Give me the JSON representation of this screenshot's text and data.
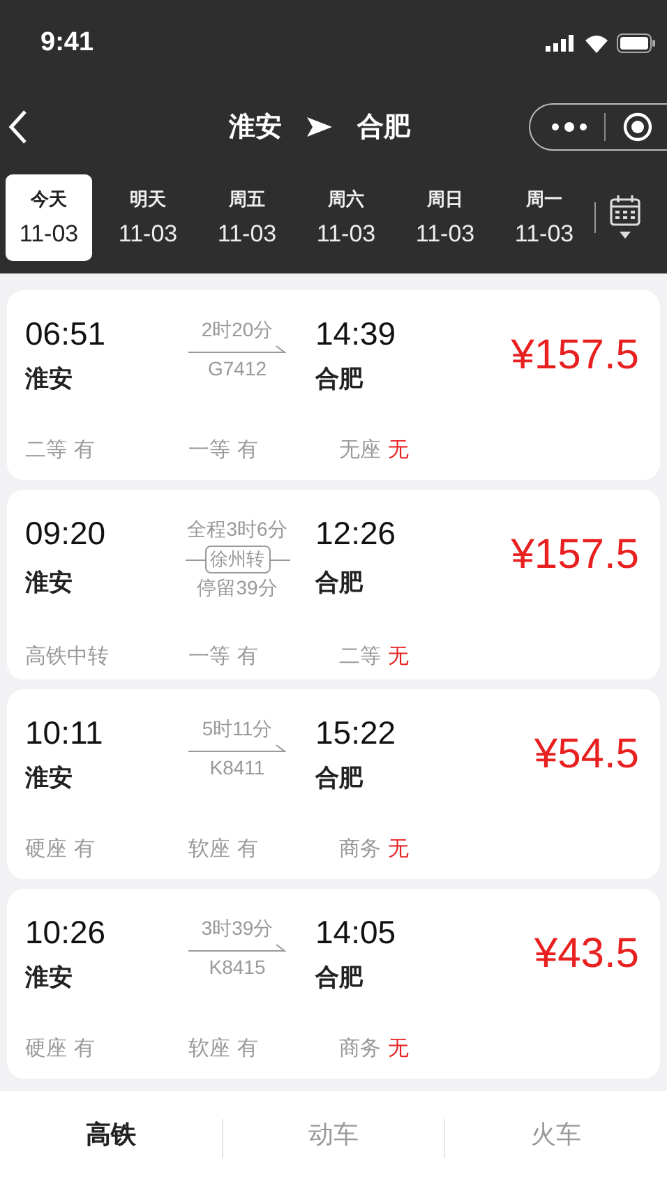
{
  "status_bar": {
    "time": "9:41"
  },
  "nav": {
    "from": "淮安",
    "to": "合肥"
  },
  "dates": [
    {
      "day": "今天",
      "date": "11-03",
      "selected": true
    },
    {
      "day": "明天",
      "date": "11-03",
      "selected": false
    },
    {
      "day": "周五",
      "date": "11-03",
      "selected": false
    },
    {
      "day": "周六",
      "date": "11-03",
      "selected": false
    },
    {
      "day": "周日",
      "date": "11-03",
      "selected": false
    },
    {
      "day": "周一",
      "date": "11-03",
      "selected": false
    }
  ],
  "trains": [
    {
      "kind": "direct",
      "depart": "06:51",
      "from": "淮安",
      "duration": "2时20分",
      "train_no": "G7412",
      "arrive": "14:39",
      "to": "合肥",
      "price": "¥157.5",
      "seats": [
        {
          "label": "二等",
          "status": "有",
          "available": true
        },
        {
          "label": "一等",
          "status": "有",
          "available": true
        },
        {
          "label": "无座",
          "status": "无",
          "available": false
        }
      ]
    },
    {
      "kind": "transfer",
      "depart": "09:20",
      "from": "淮安",
      "total": "全程3时6分",
      "via": "徐州转",
      "stop": "停留39分",
      "arrive": "12:26",
      "to": "合肥",
      "price": "¥157.5",
      "seats": [
        {
          "label": "高铁中转"
        },
        {
          "label": "一等",
          "status": "有",
          "available": true
        },
        {
          "label": "二等",
          "status": "无",
          "available": false
        }
      ]
    },
    {
      "kind": "direct",
      "depart": "10:11",
      "from": "淮安",
      "duration": "5时11分",
      "train_no": "K8411",
      "arrive": "15:22",
      "to": "合肥",
      "price": "¥54.5",
      "seats": [
        {
          "label": "硬座",
          "status": "有",
          "available": true
        },
        {
          "label": "软座",
          "status": "有",
          "available": true
        },
        {
          "label": "商务",
          "status": "无",
          "available": false
        }
      ]
    },
    {
      "kind": "direct",
      "depart": "10:26",
      "from": "淮安",
      "duration": "3时39分",
      "train_no": "K8415",
      "arrive": "14:05",
      "to": "合肥",
      "price": "¥43.5",
      "seats": [
        {
          "label": "硬座",
          "status": "有",
          "available": true
        },
        {
          "label": "软座",
          "status": "有",
          "available": true
        },
        {
          "label": "商务",
          "status": "无",
          "available": false
        }
      ]
    }
  ],
  "bottom_tabs": [
    {
      "label": "高铁",
      "selected": true
    },
    {
      "label": "动车",
      "selected": false
    },
    {
      "label": "火车",
      "selected": false
    }
  ]
}
